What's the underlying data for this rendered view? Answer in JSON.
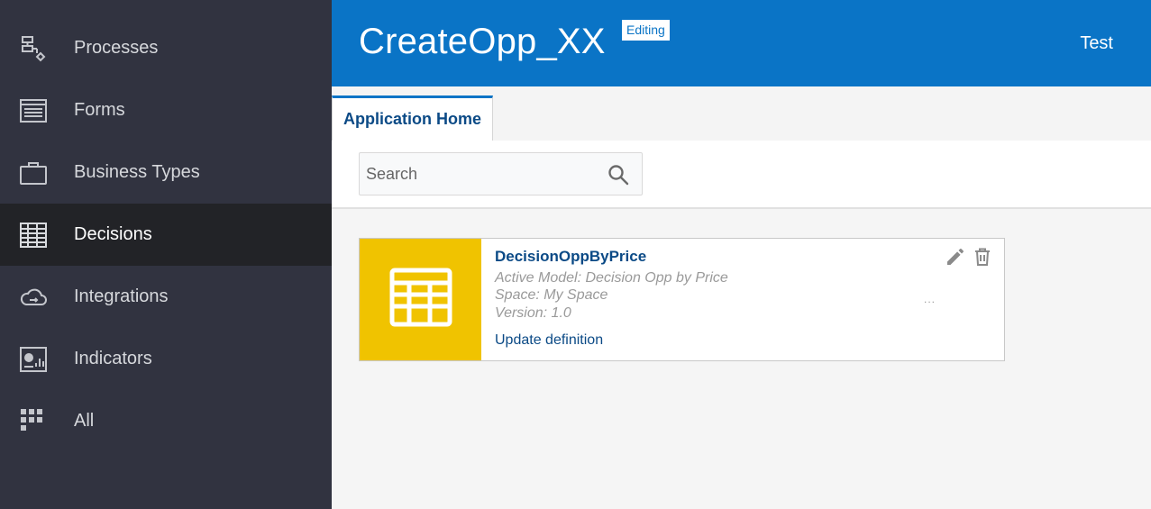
{
  "sidebar": {
    "items": [
      {
        "label": "Processes",
        "icon": "processes-icon"
      },
      {
        "label": "Forms",
        "icon": "forms-icon"
      },
      {
        "label": "Business Types",
        "icon": "briefcase-icon"
      },
      {
        "label": "Decisions",
        "icon": "table-icon",
        "active": true
      },
      {
        "label": "Integrations",
        "icon": "cloud-icon"
      },
      {
        "label": "Indicators",
        "icon": "chart-icon"
      },
      {
        "label": "All",
        "icon": "grid-icon"
      }
    ]
  },
  "header": {
    "title": "CreateOpp_XX",
    "badge": "Editing",
    "user": "Test"
  },
  "tabs": [
    {
      "label": "Application Home",
      "active": true
    }
  ],
  "search": {
    "placeholder": "Search",
    "value": ""
  },
  "cards": [
    {
      "title": "DecisionOppByPrice",
      "active_model": "Active Model: Decision Opp by Price",
      "space": "Space: My Space",
      "version": "Version: 1.0",
      "link": "Update definition",
      "more": "...",
      "thumb_icon": "decision-table-icon"
    }
  ],
  "colors": {
    "sidebar_bg": "#313340",
    "sidebar_active_bg": "#222327",
    "header_bg": "#0a74c6",
    "card_thumb_bg": "#f0c300",
    "link_color": "#0b4a86"
  }
}
